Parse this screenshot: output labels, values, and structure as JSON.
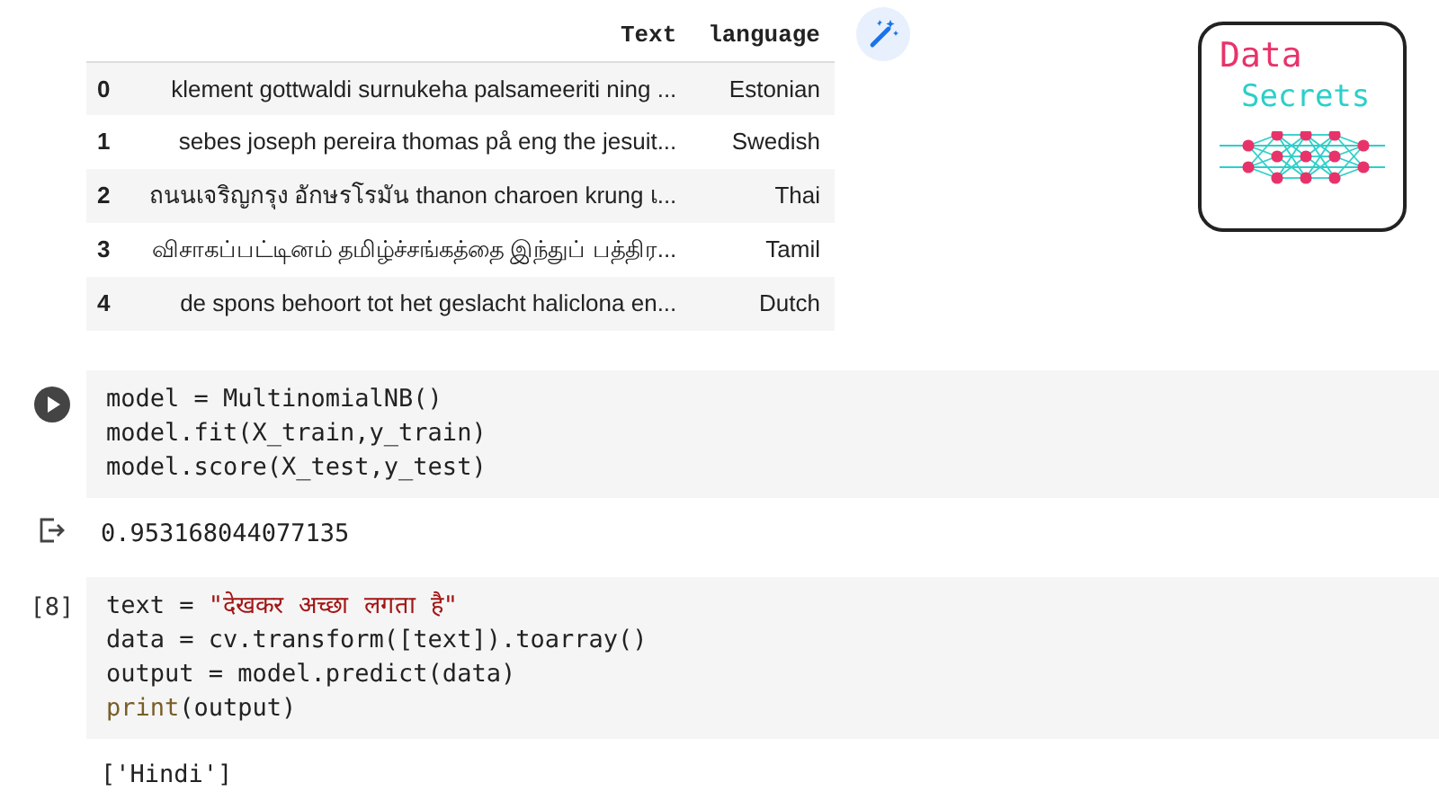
{
  "table": {
    "columns": [
      "",
      "Text",
      "language"
    ],
    "rows": [
      {
        "index": "0",
        "text": "klement gottwaldi surnukeha palsameeriti ning ...",
        "language": "Estonian"
      },
      {
        "index": "1",
        "text": "sebes joseph pereira thomas på eng the jesuit...",
        "language": "Swedish"
      },
      {
        "index": "2",
        "text": "ถนนเจริญกรุง อักษรโรมัน thanon charoen krung เ...",
        "language": "Thai"
      },
      {
        "index": "3",
        "text": "விசாகப்பட்டினம் தமிழ்ச்சங்கத்தை இந்துப் பத்திர...",
        "language": "Tamil"
      },
      {
        "index": "4",
        "text": "de spons behoort tot het geslacht haliclona en...",
        "language": "Dutch"
      }
    ]
  },
  "logo": {
    "title": "Data",
    "subtitle": "Secrets"
  },
  "cells": [
    {
      "kind": "run",
      "code": [
        [
          {
            "kind": "plain",
            "text": "model = MultinomialNB()"
          }
        ],
        [
          {
            "kind": "plain",
            "text": "model.fit(X_train,y_train)"
          }
        ],
        [
          {
            "kind": "plain",
            "text": "model.score(X_test,y_test)"
          }
        ]
      ],
      "output": {
        "kind": "result",
        "text": "0.953168044077135"
      }
    },
    {
      "kind": "executed",
      "count": "[8]",
      "code": [
        [
          {
            "kind": "plain",
            "text": "text = "
          },
          {
            "kind": "string",
            "text": "\"देखकर अच्छा लगता है\""
          }
        ],
        [
          {
            "kind": "plain",
            "text": "data = cv.transform([text]).toarray()"
          }
        ],
        [
          {
            "kind": "plain",
            "text": "output = model.predict(data)"
          }
        ],
        [
          {
            "kind": "builtin",
            "text": "print"
          },
          {
            "kind": "plain",
            "text": "(output)"
          }
        ]
      ],
      "output": {
        "kind": "plain",
        "text": "['Hindi']"
      }
    }
  ]
}
